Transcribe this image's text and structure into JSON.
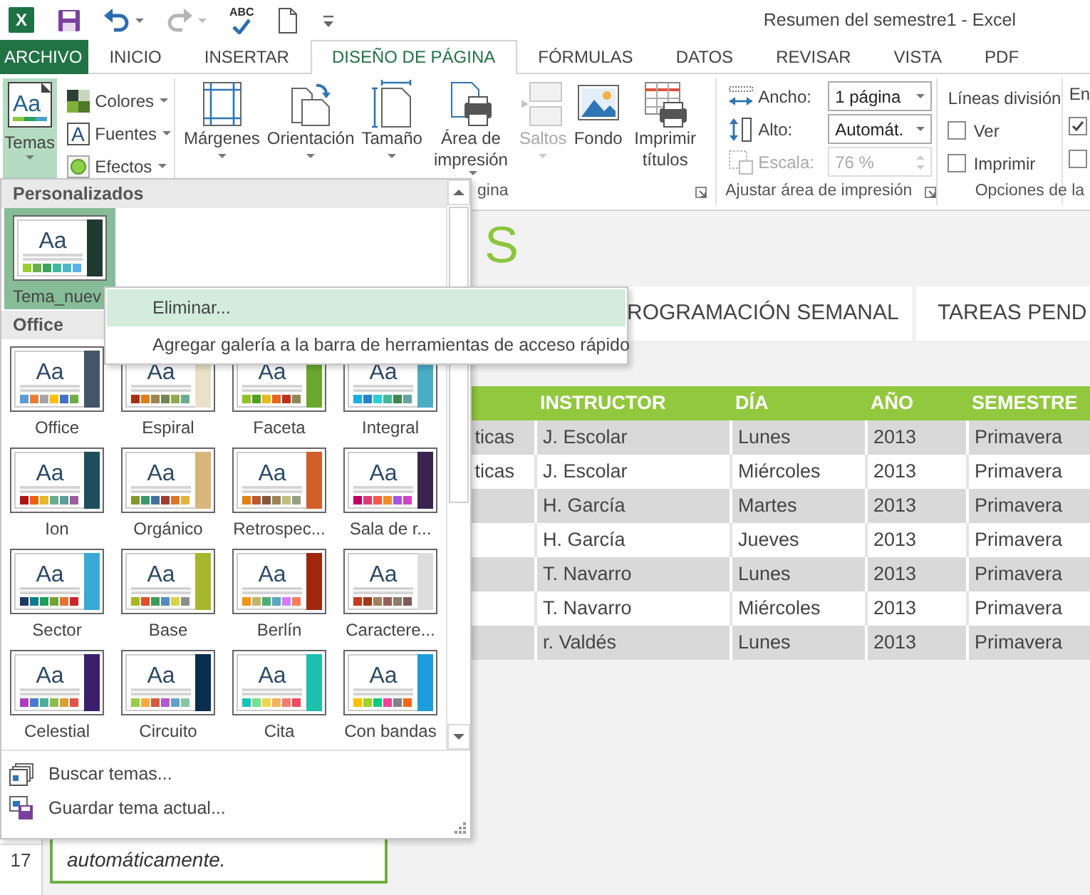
{
  "window": {
    "title": "Resumen del semestre1 - Excel",
    "app_logo": "X"
  },
  "quick_access": [
    {
      "kind": "save",
      "disabled": false
    },
    {
      "kind": "undo",
      "disabled": false
    },
    {
      "kind": "redo",
      "disabled": true
    },
    {
      "kind": "spelling",
      "text": "ABC",
      "disabled": false
    },
    {
      "kind": "new",
      "disabled": false
    },
    {
      "kind": "customize",
      "disabled": false
    }
  ],
  "ribbon_tabs": [
    {
      "label": "ARCHIVO",
      "kind": "file",
      "selected": false
    },
    {
      "label": "INICIO",
      "kind": "tab",
      "selected": false
    },
    {
      "label": "INSERTAR",
      "kind": "tab",
      "selected": false
    },
    {
      "label": "DISEÑO DE PÁGINA",
      "kind": "tab",
      "selected": true
    },
    {
      "label": "FÓRMULAS",
      "kind": "tab",
      "selected": false
    },
    {
      "label": "DATOS",
      "kind": "tab",
      "selected": false
    },
    {
      "label": "REVISAR",
      "kind": "tab",
      "selected": false
    },
    {
      "label": "VISTA",
      "kind": "tab",
      "selected": false
    },
    {
      "label": "PDF",
      "kind": "tab",
      "selected": false
    }
  ],
  "ribbon": {
    "themes_group": {
      "themes_button": {
        "label": "Temas",
        "icon_text": "Aa",
        "pressed": true
      },
      "options": [
        {
          "kind": "colors",
          "label": "Colores"
        },
        {
          "kind": "fonts",
          "label": "Fuentes",
          "icon_text": "A"
        },
        {
          "kind": "effects",
          "label": "Efectos"
        }
      ]
    },
    "page_setup_group": {
      "label": "gina",
      "buttons": [
        {
          "kind": "margins",
          "label": "Márgenes",
          "dropdown": true,
          "disabled": false
        },
        {
          "kind": "orientation",
          "label": "Orientación",
          "dropdown": true,
          "disabled": false
        },
        {
          "kind": "size",
          "label": "Tamaño",
          "dropdown": true,
          "disabled": false
        },
        {
          "kind": "print_area",
          "label": "Área de impresión",
          "dropdown": true,
          "disabled": false
        },
        {
          "kind": "breaks",
          "label": "Saltos",
          "dropdown": true,
          "disabled": true
        },
        {
          "kind": "background",
          "label": "Fondo",
          "dropdown": false,
          "disabled": false
        },
        {
          "kind": "print_titles",
          "label": "Imprimir títulos",
          "dropdown": false,
          "disabled": false
        }
      ]
    },
    "scale_group": {
      "label": "Ajustar área de impresión",
      "fields": [
        {
          "kind": "width",
          "label": "Ancho:",
          "value": "1 página",
          "disabled": false
        },
        {
          "kind": "height",
          "label": "Alto:",
          "value": "Automát.",
          "disabled": false
        },
        {
          "kind": "scale",
          "label": "Escala:",
          "value": "76 %",
          "disabled": true
        }
      ]
    },
    "sheet_options_group": {
      "label": "Opciones de la",
      "heading": "Líneas división",
      "checkboxes": [
        {
          "label": "Ver",
          "checked": false
        },
        {
          "label": "Imprimir",
          "checked": false
        }
      ],
      "next_heading": "En",
      "next_checkboxes": [
        {
          "checked": true
        },
        {
          "checked": false
        }
      ]
    }
  },
  "sheet": {
    "title": "S",
    "tabs": [
      {
        "label": "ROGRAMACIÓN SEMANAL"
      },
      {
        "label": "TAREAS PEND"
      }
    ],
    "table": {
      "columns": [
        "INSTRUCTOR",
        "DÍA",
        "AÑO",
        "SEMESTRE"
      ],
      "rows": [
        {
          "column_1": "ticas",
          "instructor": "J. Escolar",
          "day": "Lunes",
          "year": "2013",
          "semester": "Primavera"
        },
        {
          "column_1": "ticas",
          "instructor": "J. Escolar",
          "day": "Miércoles",
          "year": "2013",
          "semester": "Primavera"
        },
        {
          "instructor": "H. García",
          "day": "Martes",
          "year": "2013",
          "semester": "Primavera"
        },
        {
          "instructor": "H. García",
          "day": "Jueves",
          "year": "2013",
          "semester": "Primavera"
        },
        {
          "instructor": "T. Navarro",
          "day": "Lunes",
          "year": "2013",
          "semester": "Primavera"
        },
        {
          "instructor": "T. Navarro",
          "day": "Miércoles",
          "year": "2013",
          "semester": "Primavera"
        },
        {
          "instructor": "r. Valdés",
          "day": "Lunes",
          "year": "2013",
          "semester": "Primavera"
        }
      ]
    },
    "row_numbers": [
      "17"
    ],
    "note": {
      "text": "automáticamente."
    }
  },
  "themes_menu": {
    "sections": [
      {
        "title": "Personalizados",
        "themes": [
          {
            "name": "Tema_nuev",
            "sample": "Aa",
            "selected": true,
            "accent": {
              "color": "#1f3a2e"
            },
            "swatches": [
              {
                "color": "#9acd32"
              },
              {
                "color": "#6ab04c"
              },
              {
                "color": "#3aa35c"
              },
              {
                "color": "#40b8a0"
              },
              {
                "color": "#4fb6c8"
              },
              {
                "color": "#5ab4e8"
              }
            ]
          }
        ]
      },
      {
        "title": "Office",
        "themes": [
          {
            "name": "Office",
            "sample": "Aa",
            "selected": false,
            "accent": {
              "color": "#44546a"
            },
            "swatches": [
              {
                "color": "#5b9bd5"
              },
              {
                "color": "#ed7d31"
              },
              {
                "color": "#a5a5a5"
              },
              {
                "color": "#ffc000"
              },
              {
                "color": "#4472c4"
              },
              {
                "color": "#70ad47"
              }
            ]
          },
          {
            "name": "Espiral",
            "sample": "Aa",
            "selected": false,
            "accent": {
              "color": "#e8e2c8"
            },
            "swatches": [
              {
                "color": "#a53010"
              },
              {
                "color": "#de7e18"
              },
              {
                "color": "#9f8351"
              },
              {
                "color": "#728653"
              },
              {
                "color": "#92aa4c"
              },
              {
                "color": "#6aac91"
              }
            ]
          },
          {
            "name": "Faceta",
            "sample": "Aa",
            "selected": false,
            "accent": {
              "color": "#6aa82e"
            },
            "swatches": [
              {
                "color": "#90c226"
              },
              {
                "color": "#54a021"
              },
              {
                "color": "#e6b91e"
              },
              {
                "color": "#e76618"
              },
              {
                "color": "#c42f1a"
              },
              {
                "color": "#918655"
              }
            ]
          },
          {
            "name": "Integral",
            "sample": "Aa",
            "selected": false,
            "accent": {
              "color": "#4bacc6"
            },
            "swatches": [
              {
                "color": "#1cade4"
              },
              {
                "color": "#2683c6"
              },
              {
                "color": "#27ced7"
              },
              {
                "color": "#42ba97"
              },
              {
                "color": "#3e8853"
              },
              {
                "color": "#62a39f"
              }
            ]
          },
          {
            "name": "Ion",
            "sample": "Aa",
            "selected": false,
            "accent": {
              "color": "#1e4d5c"
            },
            "swatches": [
              {
                "color": "#b01513"
              },
              {
                "color": "#ea6312"
              },
              {
                "color": "#e6b729"
              },
              {
                "color": "#6aac90"
              },
              {
                "color": "#5f9c9d"
              },
              {
                "color": "#9e5e9b"
              }
            ]
          },
          {
            "name": "Orgánico",
            "sample": "Aa",
            "selected": false,
            "accent": {
              "color": "#d9b57a"
            },
            "swatches": [
              {
                "color": "#83992a"
              },
              {
                "color": "#3c9770"
              },
              {
                "color": "#44709d"
              },
              {
                "color": "#a23c33"
              },
              {
                "color": "#d97828"
              },
              {
                "color": "#deb340"
              }
            ]
          },
          {
            "name": "Retrospec...",
            "sample": "Aa",
            "selected": false,
            "accent": {
              "color": "#d05f2a"
            },
            "swatches": [
              {
                "color": "#e48312"
              },
              {
                "color": "#bd582c"
              },
              {
                "color": "#865640"
              },
              {
                "color": "#9b8357"
              },
              {
                "color": "#c2bc80"
              },
              {
                "color": "#94a088"
              }
            ]
          },
          {
            "name": "Sala de r...",
            "sample": "Aa",
            "selected": false,
            "accent": {
              "color": "#3b2350"
            },
            "swatches": [
              {
                "color": "#c00066"
              },
              {
                "color": "#e23a74"
              },
              {
                "color": "#ef5c4a"
              },
              {
                "color": "#f08e2c"
              },
              {
                "color": "#a855e0"
              },
              {
                "color": "#d046c8"
              }
            ]
          },
          {
            "name": "Sector",
            "sample": "Aa",
            "selected": false,
            "accent": {
              "color": "#3aa8d8"
            },
            "swatches": [
              {
                "color": "#203864"
              },
              {
                "color": "#0e7c89"
              },
              {
                "color": "#1ba05b"
              },
              {
                "color": "#71a532"
              },
              {
                "color": "#e07534"
              },
              {
                "color": "#c9282d"
              }
            ]
          },
          {
            "name": "Base",
            "sample": "Aa",
            "selected": false,
            "accent": {
              "color": "#a5b72e"
            },
            "swatches": [
              {
                "color": "#a8b820"
              },
              {
                "color": "#e04f2a"
              },
              {
                "color": "#3f9a5a"
              },
              {
                "color": "#4f8fc0"
              },
              {
                "color": "#d9d447"
              },
              {
                "color": "#8d8d8d"
              }
            ]
          },
          {
            "name": "Berlín",
            "sample": "Aa",
            "selected": false,
            "accent": {
              "color": "#a0260e"
            },
            "swatches": [
              {
                "color": "#f09415"
              },
              {
                "color": "#c1b56b"
              },
              {
                "color": "#4baf73"
              },
              {
                "color": "#5aa6c0"
              },
              {
                "color": "#d17df9"
              },
              {
                "color": "#fa7e5c"
              }
            ]
          },
          {
            "name": "Caractere...",
            "sample": "Aa",
            "selected": false,
            "accent": {
              "color": "#dddddd"
            },
            "swatches": [
              {
                "color": "#c43b1d"
              },
              {
                "color": "#9f3a1a"
              },
              {
                "color": "#a18060"
              },
              {
                "color": "#946055"
              },
              {
                "color": "#8e7a6b"
              },
              {
                "color": "#7a5a58"
              }
            ]
          },
          {
            "name": "Celestial",
            "sample": "Aa",
            "selected": false,
            "accent": {
              "color": "#3b1f6e"
            },
            "swatches": [
              {
                "color": "#ac3ec1"
              },
              {
                "color": "#477bd1"
              },
              {
                "color": "#46b298"
              },
              {
                "color": "#90ba4c"
              },
              {
                "color": "#dd9d31"
              },
              {
                "color": "#e25247"
              }
            ]
          },
          {
            "name": "Circuito",
            "sample": "Aa",
            "selected": false,
            "accent": {
              "color": "#0a2f4e"
            },
            "swatches": [
              {
                "color": "#9acd4c"
              },
              {
                "color": "#faa93a"
              },
              {
                "color": "#d35940"
              },
              {
                "color": "#b258d3"
              },
              {
                "color": "#63a0cc"
              },
              {
                "color": "#8ac4a7"
              }
            ]
          },
          {
            "name": "Cita",
            "sample": "Aa",
            "selected": false,
            "accent": {
              "color": "#1fbfae"
            },
            "swatches": [
              {
                "color": "#18c5b3"
              },
              {
                "color": "#78e08c"
              },
              {
                "color": "#f0d44a"
              },
              {
                "color": "#f4b15a"
              },
              {
                "color": "#f27d6b"
              },
              {
                "color": "#ef4a62"
              }
            ]
          },
          {
            "name": "Con bandas",
            "sample": "Aa",
            "selected": false,
            "accent": {
              "color": "#1d9ddb"
            },
            "swatches": [
              {
                "color": "#ffc000"
              },
              {
                "color": "#a5d028"
              },
              {
                "color": "#08cc78"
              },
              {
                "color": "#f24099"
              },
              {
                "color": "#828288"
              },
              {
                "color": "#f56617"
              }
            ]
          }
        ]
      }
    ],
    "commands": [
      {
        "kind": "browse",
        "label": "Buscar temas..."
      },
      {
        "kind": "save",
        "label": "Guardar tema actual..."
      }
    ]
  },
  "context_menu": {
    "items": [
      {
        "label": "Eliminar...",
        "selected": true
      },
      {
        "label": "Agregar galería a la barra de herramientas de acceso rápido",
        "selected": false
      }
    ]
  }
}
